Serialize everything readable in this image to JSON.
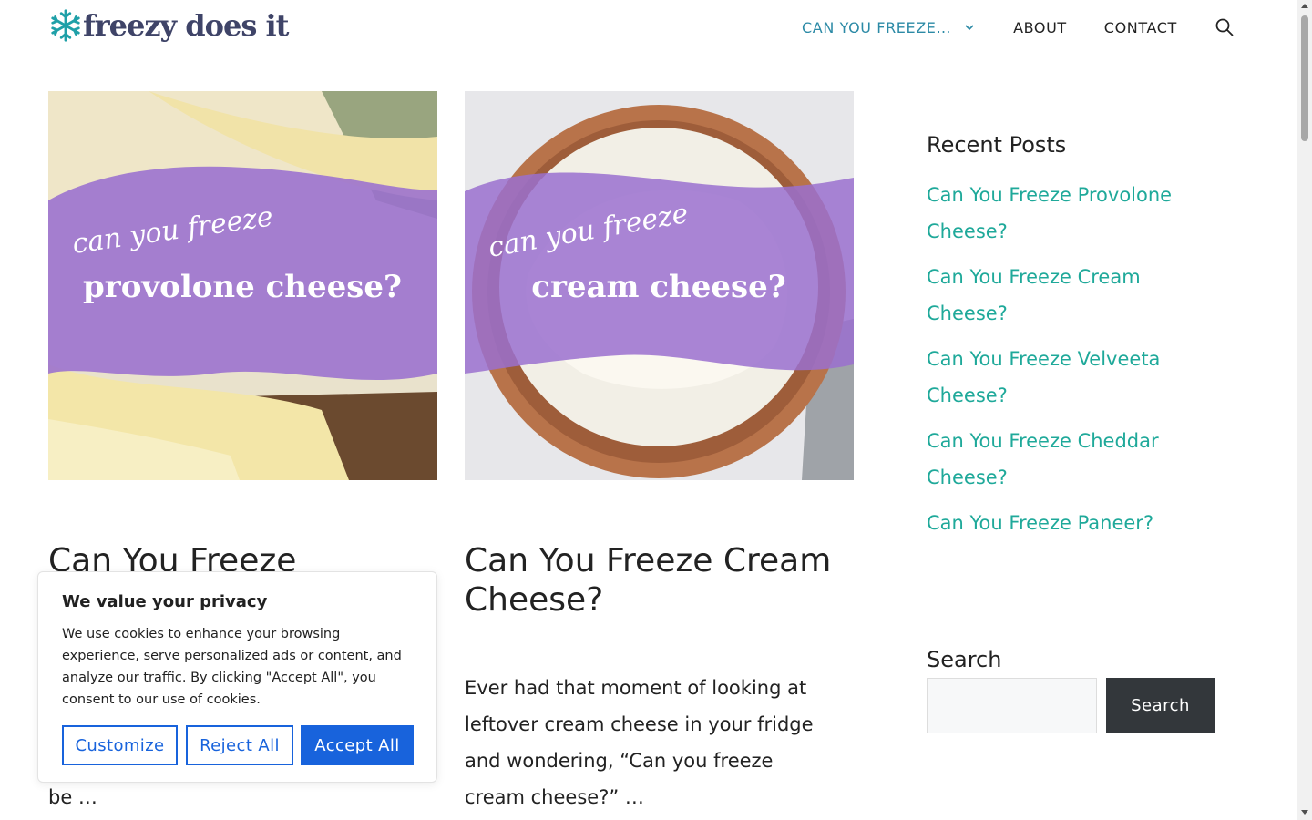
{
  "header": {
    "logo_text": "freezy does it",
    "nav": [
      {
        "label": "CAN YOU FREEZE…"
      },
      {
        "label": "ABOUT"
      },
      {
        "label": "CONTACT"
      }
    ],
    "search_icon": "search-icon",
    "colors": {
      "logo": "#3f4468",
      "nav_active": "#2c8aa6"
    }
  },
  "posts": [
    {
      "image": {
        "line1": "can you freeze",
        "line2": "provolone cheese?"
      },
      "title": "Can You Freeze",
      "excerpt_tail": "be …"
    },
    {
      "image": {
        "line1": "can you freeze",
        "line2": "cream cheese?"
      },
      "title_line1": "Can You Freeze Cream",
      "title_line2": "Cheese?",
      "excerpt_lines": [
        "Ever had that moment of looking at",
        "leftover cream cheese in your fridge",
        "and wondering, “Can you freeze",
        "cream cheese?” …"
      ]
    }
  ],
  "sidebar": {
    "recent_title": "Recent Posts",
    "recent_posts": [
      {
        "line1": "Can You Freeze Provolone",
        "line2": "Cheese?"
      },
      {
        "line1": "Can You Freeze Cream",
        "line2": "Cheese?"
      },
      {
        "line1": "Can You Freeze Velveeta",
        "line2": "Cheese?"
      },
      {
        "line1": "Can You Freeze Cheddar",
        "line2": "Cheese?"
      },
      {
        "line1": "Can You Freeze Paneer?",
        "line2": ""
      }
    ],
    "search_title": "Search",
    "search_button": "Search",
    "link_color": "#1fa99a"
  },
  "cookie_banner": {
    "title": "We value your privacy",
    "text": "We use cookies to enhance your browsing experience, serve personalized ads or content, and analyze our traffic. By clicking \"Accept All\", you consent to our use of cookies.",
    "buttons": {
      "customize": "Customize",
      "reject": "Reject All",
      "accept": "Accept All"
    },
    "accent": "#1863dc"
  }
}
